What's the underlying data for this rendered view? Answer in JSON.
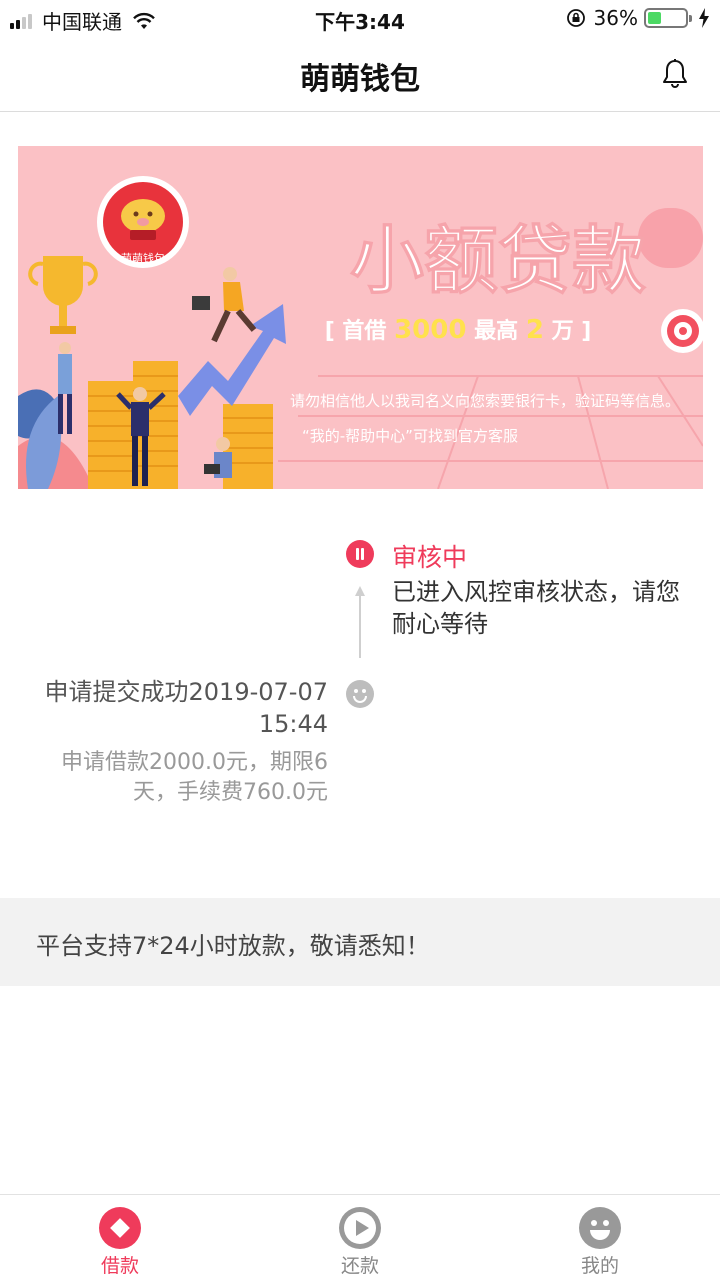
{
  "status_bar": {
    "carrier": "中国联通",
    "time": "下午3:44",
    "battery_percent_text": "36%",
    "battery_level": 0.36
  },
  "nav": {
    "title": "萌萌钱包"
  },
  "banner": {
    "logo_text": "萌萌钱包",
    "headline": "小额贷款",
    "subline_prefix": "[ 首借",
    "subline_amount": "3000",
    "subline_mid": "最高",
    "subline_max": "2",
    "subline_suffix": "万 ]",
    "warning_line": "请勿相信他人以我司名义向您索要银行卡，验证码等信息。",
    "help_line": "“我的-帮助中心”可找到官方客服"
  },
  "timeline": {
    "current_status": "审核中",
    "current_desc": "已进入风控审核状态，请您耐心等待",
    "submit_title": "申请提交成功2019-07-07 15:44",
    "submit_desc": "申请借款2000.0元，期限6天，手续费760.0元"
  },
  "notice": {
    "text": "平台支持7*24小时放款，敬请悉知！"
  },
  "tabs": [
    {
      "label": "借款",
      "icon": "borrow-icon",
      "active": true
    },
    {
      "label": "还款",
      "icon": "play-icon",
      "active": false
    },
    {
      "label": "我的",
      "icon": "smiley-icon",
      "active": false
    }
  ],
  "colors": {
    "accent": "#ef3b5b",
    "banner_bg": "#fbc1c5",
    "inactive": "#999999"
  }
}
